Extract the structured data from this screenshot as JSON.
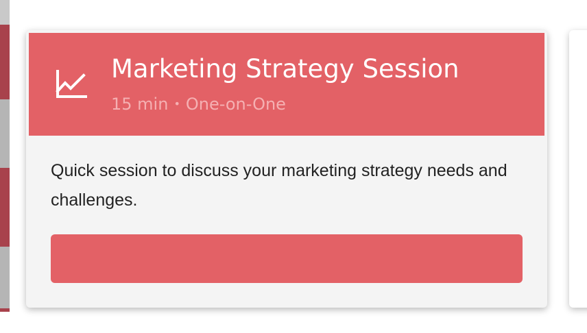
{
  "card": {
    "title": "Marketing Strategy Session",
    "duration": "15 min",
    "separator": "•",
    "type": "One-on-One",
    "icon": "line-chart-icon",
    "description": "Quick session to discuss your marketing strategy needs and challenges.",
    "button_label": ""
  },
  "colors": {
    "accent": "#e36166",
    "card_background": "#f4f4f4",
    "meta_text": "#f5b0b2",
    "body_text": "#222222"
  }
}
